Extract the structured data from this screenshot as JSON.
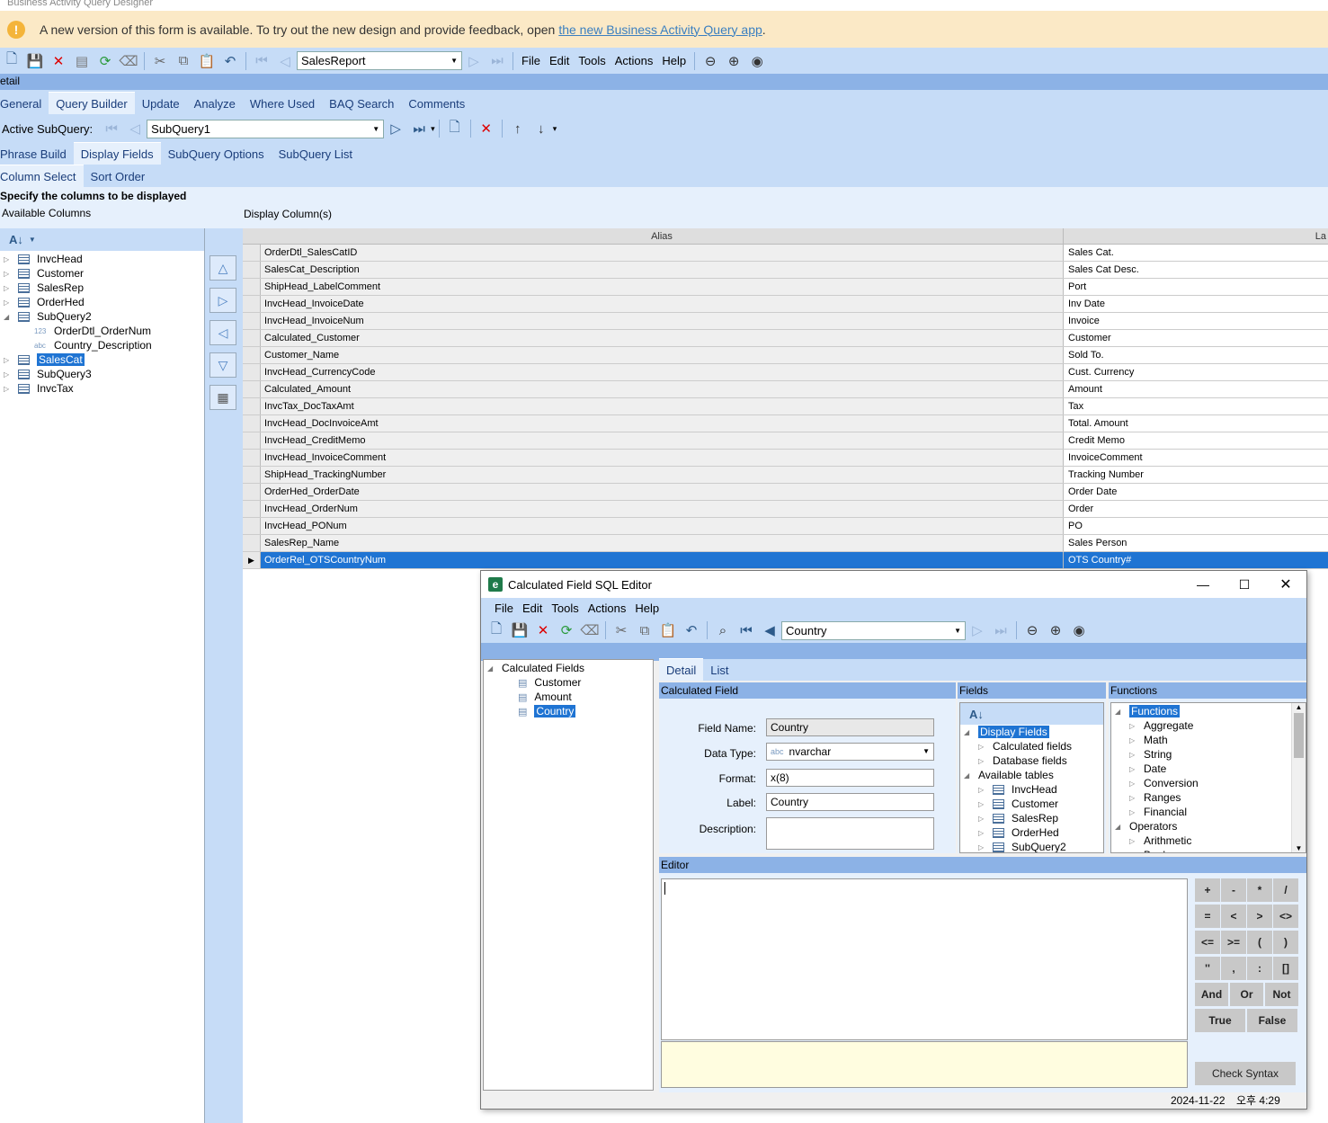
{
  "window_title": "Business Activity Query Designer",
  "notice": {
    "text": "A new version of this form is available. To try out the new design and provide feedback, open",
    "link": "the new Business Activity Query app",
    "end": "."
  },
  "toolbar": {
    "combo_value": "SalesReport",
    "menu": [
      "File",
      "Edit",
      "Tools",
      "Actions",
      "Help"
    ]
  },
  "detail_label": "etail",
  "main_tabs": [
    "General",
    "Query Builder",
    "Update",
    "Analyze",
    "Where Used",
    "BAQ Search",
    "Comments"
  ],
  "active_subquery": {
    "label": "Active SubQuery:",
    "value": "SubQuery1"
  },
  "sub_tabs": [
    "Phrase Build",
    "Display Fields",
    "SubQuery Options",
    "SubQuery List"
  ],
  "col_tabs": [
    "Column Select",
    "Sort Order"
  ],
  "spec_text": "Specify the columns to be displayed",
  "available_label": "Available Columns",
  "display_label": "Display Column(s)",
  "tree": [
    {
      "label": "InvcHead",
      "type": "table",
      "level": 0
    },
    {
      "label": "Customer",
      "type": "table",
      "level": 0
    },
    {
      "label": "SalesRep",
      "type": "table",
      "level": 0
    },
    {
      "label": "OrderHed",
      "type": "table",
      "level": 0
    },
    {
      "label": "SubQuery2",
      "type": "table",
      "level": 0,
      "open": true
    },
    {
      "label": "OrderDtl_OrderNum",
      "type": "num",
      "level": 1,
      "prefix": "123"
    },
    {
      "label": "Country_Description",
      "type": "abc",
      "level": 1,
      "prefix": "abc"
    },
    {
      "label": "SalesCat",
      "type": "table",
      "level": 0,
      "selected": true
    },
    {
      "label": "SubQuery3",
      "type": "table",
      "level": 0
    },
    {
      "label": "InvcTax",
      "type": "table",
      "level": 0
    }
  ],
  "grid": {
    "headers": [
      "Alias",
      "La"
    ],
    "rows": [
      [
        "OrderDtl_SalesCatID",
        "Sales Cat."
      ],
      [
        "SalesCat_Description",
        "Sales Cat Desc."
      ],
      [
        "ShipHead_LabelComment",
        "Port"
      ],
      [
        "InvcHead_InvoiceDate",
        "Inv Date"
      ],
      [
        "InvcHead_InvoiceNum",
        "Invoice"
      ],
      [
        "Calculated_Customer",
        "Customer"
      ],
      [
        "Customer_Name",
        "Sold To."
      ],
      [
        "InvcHead_CurrencyCode",
        "Cust. Currency"
      ],
      [
        "Calculated_Amount",
        "Amount"
      ],
      [
        "InvcTax_DocTaxAmt",
        "Tax"
      ],
      [
        "InvcHead_DocInvoiceAmt",
        "Total. Amount"
      ],
      [
        "InvcHead_CreditMemo",
        "Credit Memo"
      ],
      [
        "InvcHead_InvoiceComment",
        "InvoiceComment"
      ],
      [
        "ShipHead_TrackingNumber",
        "Tracking Number"
      ],
      [
        "OrderHed_OrderDate",
        "Order Date"
      ],
      [
        "InvcHead_OrderNum",
        "Order"
      ],
      [
        "InvcHead_PONum",
        "PO"
      ],
      [
        "SalesRep_Name",
        "Sales Person"
      ],
      [
        "OrderRel_OTSCountryNum",
        "OTS Country#"
      ]
    ]
  },
  "dialog": {
    "title": "Calculated Field SQL Editor",
    "menu": [
      "File",
      "Edit",
      "Tools",
      "Actions",
      "Help"
    ],
    "combo_value": "Country",
    "tree_root": "Calculated Fields",
    "tree_items": [
      "Customer",
      "Amount",
      "Country"
    ],
    "tabs": [
      "Detail",
      "List"
    ],
    "calc_field_label": "Calculated Field",
    "fields_label": "Fields",
    "functions_label": "Functions",
    "form": {
      "field_name_label": "Field Name:",
      "field_name": "Country",
      "data_type_label": "Data Type:",
      "data_type_prefix": "abc",
      "data_type": "nvarchar",
      "format_label": "Format:",
      "format": "x(8)",
      "label_label": "Label:",
      "label": "Country",
      "description_label": "Description:",
      "description": ""
    },
    "fields_tree": [
      {
        "label": "Display Fields",
        "level": 0,
        "open": true,
        "selected": true
      },
      {
        "label": "Calculated fields",
        "level": 1
      },
      {
        "label": "Database fields",
        "level": 1
      },
      {
        "label": "Available tables",
        "level": 0,
        "open": true
      },
      {
        "label": "InvcHead",
        "level": 1,
        "table": true
      },
      {
        "label": "Customer",
        "level": 1,
        "table": true
      },
      {
        "label": "SalesRep",
        "level": 1,
        "table": true
      },
      {
        "label": "OrderHed",
        "level": 1,
        "table": true
      },
      {
        "label": "SubQuery2",
        "level": 1,
        "table": true
      }
    ],
    "functions_tree": [
      {
        "label": "Functions",
        "level": 0,
        "open": true,
        "selected": true
      },
      {
        "label": "Aggregate",
        "level": 1
      },
      {
        "label": "Math",
        "level": 1
      },
      {
        "label": "String",
        "level": 1
      },
      {
        "label": "Date",
        "level": 1
      },
      {
        "label": "Conversion",
        "level": 1
      },
      {
        "label": "Ranges",
        "level": 1
      },
      {
        "label": "Financial",
        "level": 1
      },
      {
        "label": "Operators",
        "level": 0,
        "open": true
      },
      {
        "label": "Arithmetic",
        "level": 1
      },
      {
        "label": "Boolean",
        "level": 1
      }
    ],
    "editor_label": "Editor",
    "calc_keys": [
      [
        "+",
        "-",
        "*",
        "/"
      ],
      [
        "=",
        "<",
        ">",
        "<>"
      ],
      [
        "<=",
        ">=",
        "(",
        ")"
      ],
      [
        "''",
        ",",
        ":",
        "[]"
      ]
    ],
    "bool_keys": [
      "And",
      "Or",
      "Not"
    ],
    "tf_keys": [
      "True",
      "False"
    ],
    "check_syntax": "Check Syntax",
    "status_date": "2024-11-22",
    "status_time": "오후 4:29"
  },
  "colors": {
    "accent": "#1f74d3",
    "toolbar": "#c6dcf7",
    "header": "#8cb2e6",
    "notice": "#fbe9c6"
  }
}
